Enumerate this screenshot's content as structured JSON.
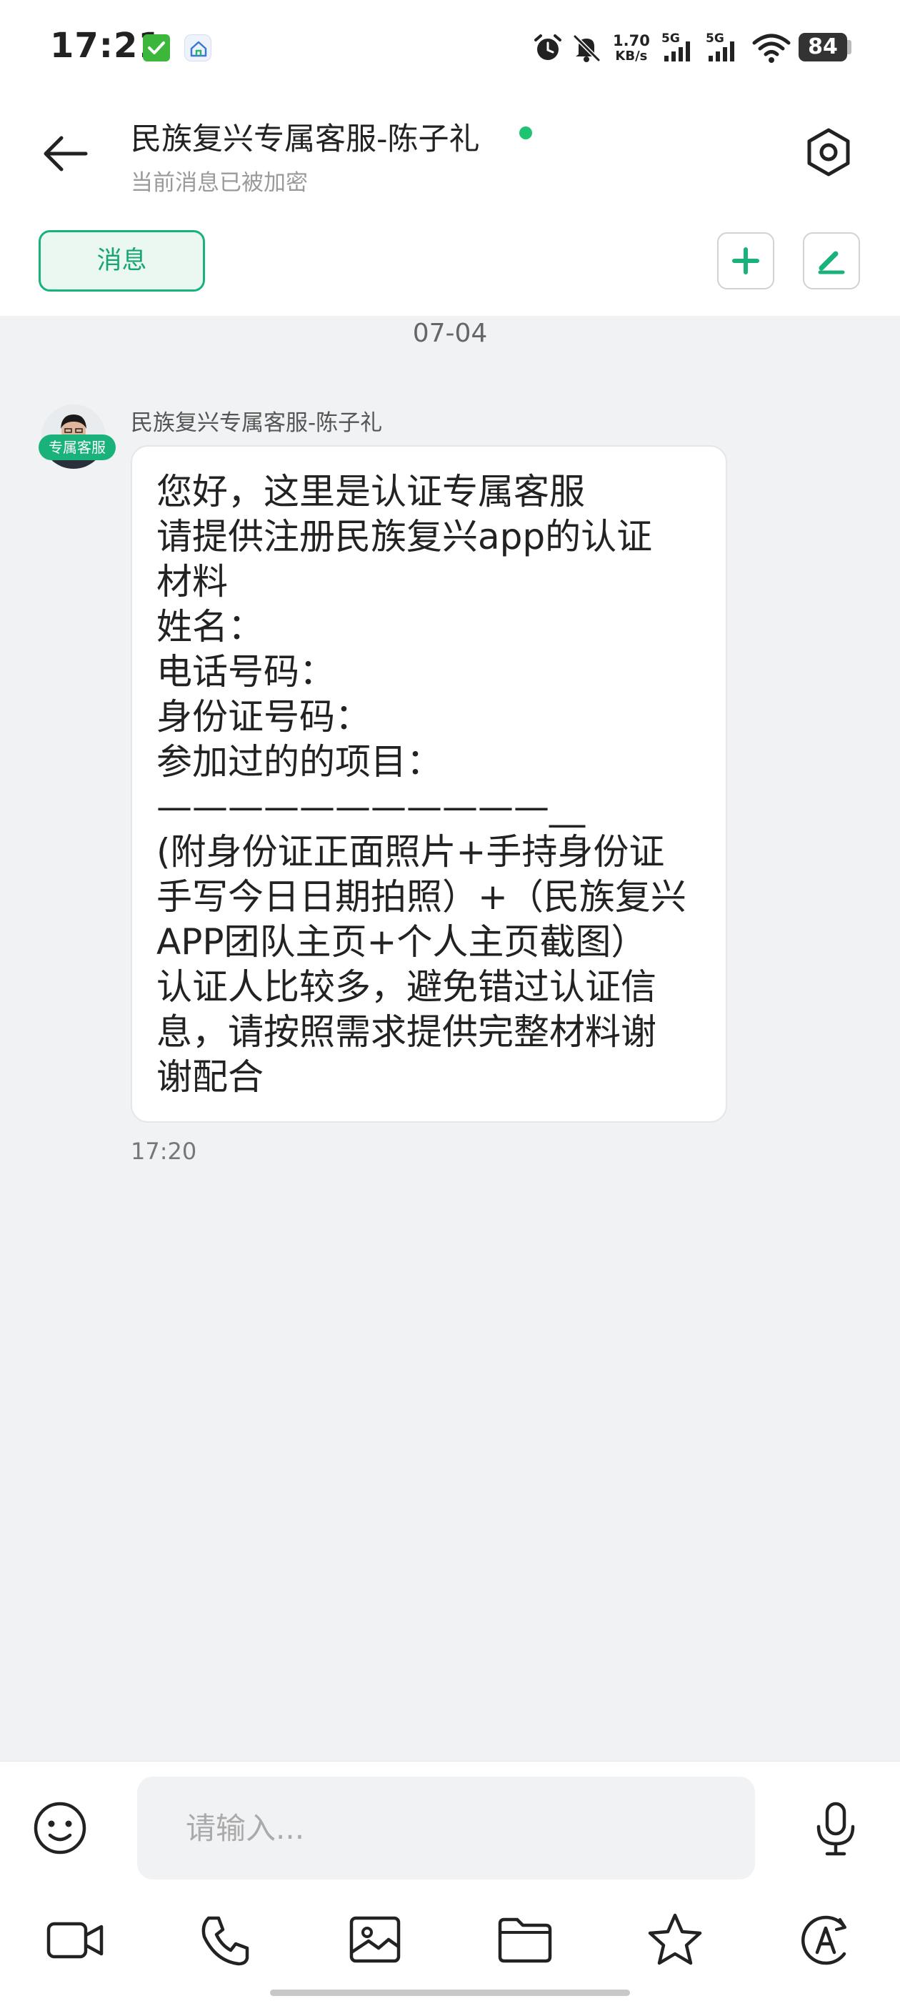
{
  "status_bar": {
    "time": "17:21",
    "net_speed_value": "1.70",
    "net_speed_unit": "KB/s",
    "signal_1": "5G",
    "signal_2": "5G",
    "battery": "84",
    "icons": [
      "checklist-app-icon",
      "home-app-icon",
      "alarm-icon",
      "mute-icon",
      "signal-icon",
      "wifi-icon",
      "battery-icon"
    ]
  },
  "header": {
    "title": "民族复兴专属客服-陈子礼",
    "subtitle": "当前消息已被加密",
    "online_color": "#1ec472",
    "tab_label": "消息"
  },
  "chat": {
    "date": "07-04",
    "sender": "民族复兴专属客服-陈子礼",
    "avatar_tag": "专属客服",
    "message_lines": [
      "您好，这里是认证专属客服",
      "请提供注册民族复兴app的认证",
      "材料",
      "姓名：",
      "电话号码：",
      "身份证号码：",
      "参加过的的项目：",
      "———————————__",
      "(附身份证正面照片+手持身份证",
      "手写今日日期拍照）+（民族复兴",
      "APP团队主页+个人主页截图）",
      "认证人比较多，避免错过认证信",
      "息，请按照需求提供完整材料谢",
      "谢配合"
    ],
    "time": "17:20"
  },
  "input": {
    "placeholder": "请输入..."
  },
  "toolbar_icons": [
    "video-call-icon",
    "phone-icon",
    "image-icon",
    "folder-icon",
    "star-icon",
    "translate-icon"
  ],
  "colors": {
    "accent": "#19b27a",
    "background": "#f1f2f4"
  }
}
